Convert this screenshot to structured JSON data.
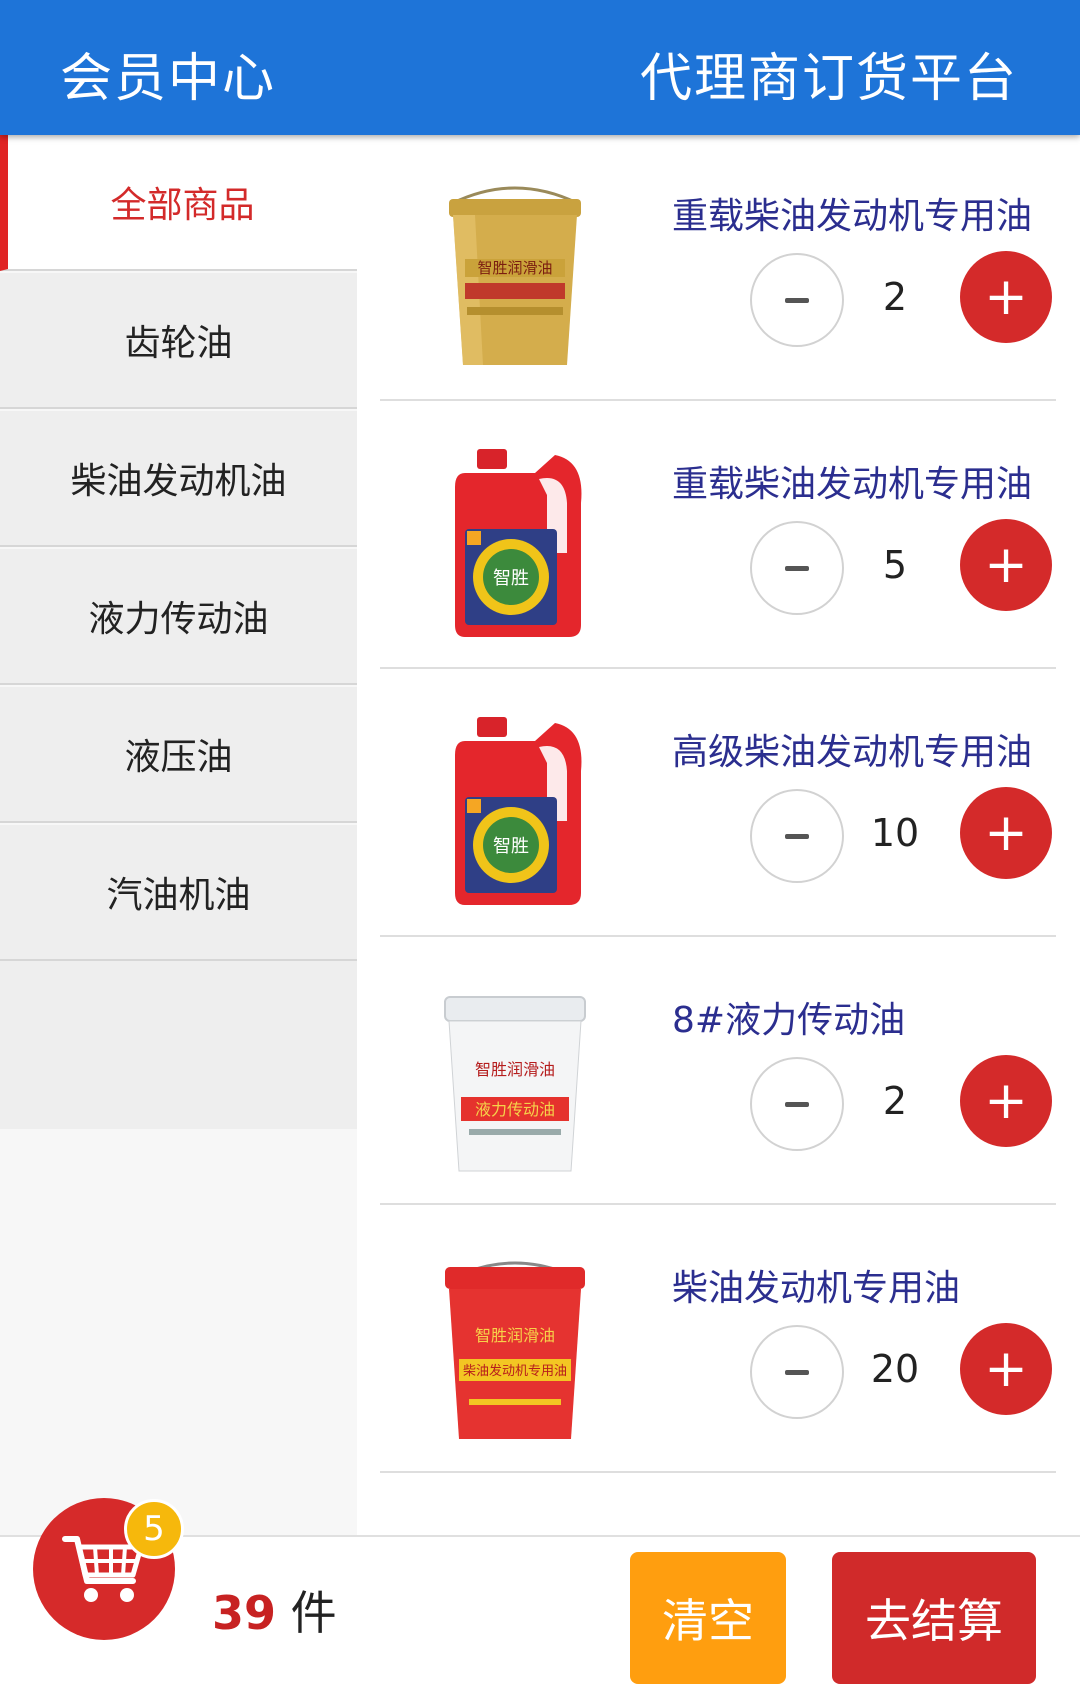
{
  "header": {
    "left_title": "会员中心",
    "right_title": "代理商订货平台"
  },
  "sidebar": {
    "items": [
      {
        "label": "全部商品"
      },
      {
        "label": "齿轮油"
      },
      {
        "label": "柴油发动机油"
      },
      {
        "label": "液力传动油"
      },
      {
        "label": "液压油"
      },
      {
        "label": "汽油机油"
      }
    ]
  },
  "products": [
    {
      "name": "重载柴油发动机专用油",
      "qty": "2",
      "image": {
        "bucket_label": "智胜润滑油"
      }
    },
    {
      "name": "重载柴油发动机专用油",
      "qty": "5",
      "image": {
        "bottle_label": "智胜"
      }
    },
    {
      "name": "高级柴油发动机专用油",
      "qty": "10",
      "image": {
        "bottle_label": "智胜"
      }
    },
    {
      "name": "8#液力传动油",
      "qty": "2",
      "image": {
        "bucket_label": "智胜润滑油",
        "band_label": "液力传动油"
      }
    },
    {
      "name": "柴油发动机专用油",
      "qty": "20",
      "image": {
        "bucket_label": "智胜润滑油",
        "band_label": "柴油发动机专用油"
      }
    }
  ],
  "cart": {
    "badge": "5",
    "count": "39",
    "unit": " 件"
  },
  "actions": {
    "clear": "清空",
    "checkout": "去结算"
  },
  "colors": {
    "header": "#1e74d8",
    "accent_red": "#d42a2a",
    "product_name": "#2b2e8f",
    "clear": "#ff9e0f",
    "badge": "#f6b80c"
  },
  "icons": {
    "cart": "shopping-cart-icon",
    "minus": "minus-icon",
    "plus": "plus-icon"
  }
}
